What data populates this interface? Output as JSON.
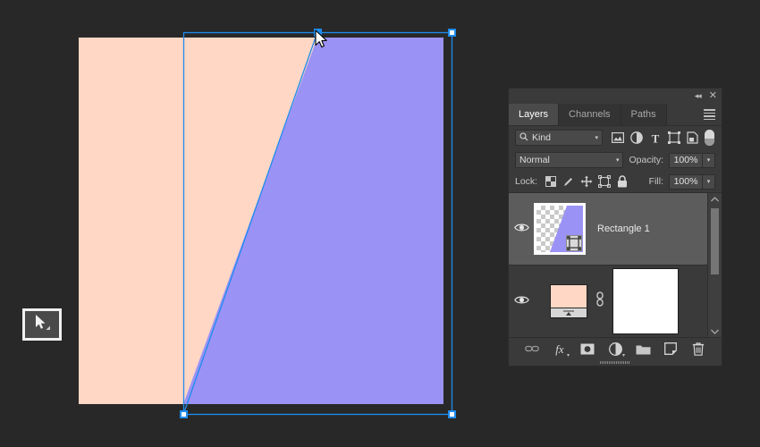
{
  "app": {
    "background_color": "#282828",
    "canvas_color": "#FFD7C4",
    "shape_color": "#9B92F5",
    "selection_color": "#1f8ced"
  },
  "toolbar": {
    "active_tool": "move-tool",
    "tool_icon": "cursor-arrow-icon"
  },
  "canvas": {
    "document_fill": "#FFD7C4",
    "shape_fill": "#9B92F5",
    "shape_name": "Rectangle 1",
    "transform_active": true,
    "handles": [
      {
        "name": "top-left-handle",
        "state": "active"
      },
      {
        "name": "top-right-handle",
        "state": "normal"
      },
      {
        "name": "bottom-left-handle",
        "state": "normal"
      },
      {
        "name": "bottom-right-handle",
        "state": "normal"
      }
    ]
  },
  "panel": {
    "titlebar": {
      "collapse_icon": "◂◂",
      "close_icon": "✕"
    },
    "tabs": [
      {
        "label": "Layers",
        "active": true
      },
      {
        "label": "Channels",
        "active": false
      },
      {
        "label": "Paths",
        "active": false
      }
    ],
    "menu_icon": "hamburger-menu-icon",
    "filter": {
      "kind_label": "Kind",
      "search_icon": "magnifier-icon",
      "caret": "▾",
      "icons": [
        {
          "name": "filter-pixel-icon"
        },
        {
          "name": "filter-adjustment-icon"
        },
        {
          "name": "filter-type-icon"
        },
        {
          "name": "filter-shape-icon"
        },
        {
          "name": "filter-smart-object-icon"
        }
      ],
      "toggle_name": "filter-enable-toggle"
    },
    "blend": {
      "mode": "Normal",
      "caret": "▾",
      "opacity_label": "Opacity:",
      "opacity_value": "100%"
    },
    "lock": {
      "label": "Lock:",
      "icons": [
        {
          "name": "lock-transparent-pixels-icon"
        },
        {
          "name": "lock-image-pixels-icon"
        },
        {
          "name": "lock-position-icon"
        },
        {
          "name": "lock-artboard-nesting-icon"
        },
        {
          "name": "lock-all-icon"
        }
      ],
      "fill_label": "Fill:",
      "fill_value": "100%"
    },
    "layers": [
      {
        "name": "Rectangle 1",
        "visible": true,
        "selected": true,
        "thumb_type": "vector-shape",
        "has_vector_badge": true,
        "eye_icon": "eye-visibility-icon"
      },
      {
        "name": "",
        "visible": true,
        "selected": false,
        "thumb_type": "gradient-fill",
        "has_link": true,
        "has_mask": true,
        "eye_icon": "eye-visibility-icon",
        "link_icon": "link-chain-icon"
      }
    ],
    "scrollbar": {
      "up_arrow": "⌃",
      "down_arrow": "⌄"
    },
    "footer_icons": [
      {
        "name": "link-layers-icon",
        "glyph": "⚭"
      },
      {
        "name": "layer-style-fx-icon",
        "glyph": "fx"
      },
      {
        "name": "add-layer-mask-icon"
      },
      {
        "name": "new-adjustment-layer-icon"
      },
      {
        "name": "new-group-icon"
      },
      {
        "name": "new-layer-icon"
      },
      {
        "name": "delete-layer-icon"
      }
    ]
  }
}
